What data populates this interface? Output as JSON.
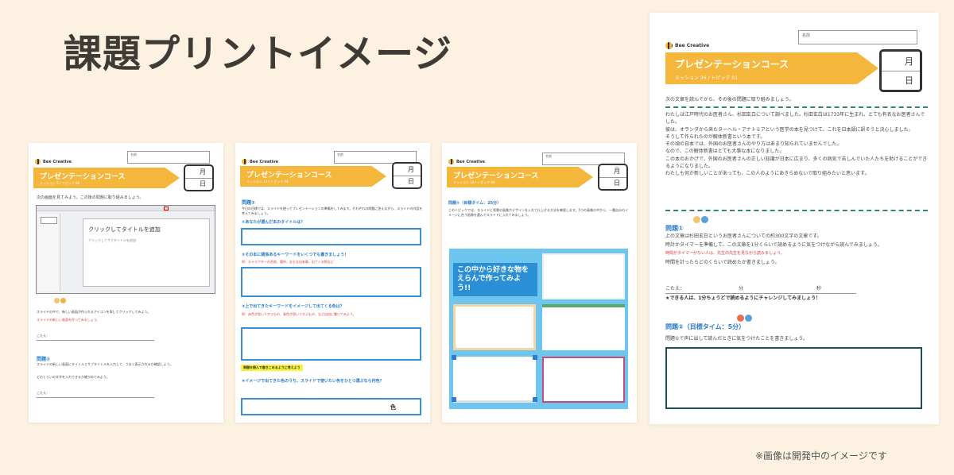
{
  "title": "課題プリントイメージ",
  "footnote": "※画像は開発中のイメージです",
  "common": {
    "brand": "Bee Creative",
    "name_label": "名前",
    "course": "プレゼンテーションコース",
    "month": "月",
    "day": "日"
  },
  "page1": {
    "sub": "ミッション 5 / トピック 04",
    "intro": "次の画面を見てみよう。この後の問題に取り組みましょう。",
    "slide_title": "クリックしてタイトルを追加",
    "slide_sub": "クリックしてサブタイトルを追加",
    "q1_text": "スライドの中で、新しい画面が作られるアイコンを探してクリックしてみよう。",
    "q1_red": "スライドの新しい画面を作ってみましょう。",
    "answer_label": "こたえ：",
    "q2_label": "問題②",
    "q2_text": "スライドの新しい画面にタイトルとサブタイトルを入力して、うまく表示されるか確認しよう。",
    "q2_text2": "どのくらいの文字を入力できるか確かめてみよう。"
  },
  "page2": {
    "sub": "ミッション 13 / トピック 04",
    "q1_label": "問題①",
    "q1_text": "今日の目標では、スライドを使ってプレゼンテーションの準備をしてみます。それぞれの問題に答えながら、スライドの内容を考えてみましょう。",
    "s1": "①あなたが選んだ本のタイトルは？",
    "s2": "②その本に関係あるキーワードをいくつでも書きましょう！",
    "s2_red": "例：キャラクターの名前、場所、おもな出来事、出てくる物など",
    "s3": "③上で出てきたキーワードをイメージして出てくる色は？",
    "s3_red": "例：赤色が思いうかぶもの、青色が思いうかぶもの、など自由に書いてみよう。",
    "hl": "問題を読んで書きこめるように考えよう",
    "s4": "④イメージで出てきた色のうち、スライドで使いたい色をひとつ選ぶなら何色？",
    "color_unit": "色"
  },
  "page3": {
    "sub": "ミッション 14 / トピック 04",
    "q1_label": "問題①（目標タイム：25分）",
    "q1_text": "このトピックでは、スライドに背景の画像やデザインを入れて仕上げる方法を練習します。5つの画像の中から、一番自分のイメージに合う画像を選んでスライドに入れてみましょう。",
    "collage_text": "この中から好きな物をえらんで作ってみよう!!"
  },
  "page4": {
    "sub": "ミッション 26 / トピック 01",
    "intro": "次の文章を読んでから、その後の問題に取り組みましょう。",
    "para": [
      "わたしは江戸時代のお医者さん、杉田玄白について調べました。杉田玄白は1733年に生まれ、とても有名なお医者さんでした。",
      "彼は、オランダから来たターヘル・アナトミアという医学の本を見つけて、これを日本語に訳そうと決心しました。",
      "そうして作られたのが解体新書という本です。",
      "その頃の日本では、外国のお医者さんのやり方はあまり知られていませんでした。",
      "なので、この解体新書はとても大事な本になりました。",
      "この本のおかげで、外国のお医者さんの正しい知識が日本に広まり、多くの病気で苦しんでいた人たちを助けることができるようになりました。",
      "わたしも何か新しいことがあっても、この人のようにあきらめないで取り組みたいと思います。"
    ],
    "q1_label": "問題①",
    "q1_text": "上の文章は杉田玄白というお医者さんについての約300文字の文章です。",
    "q1_text2": "時計かタイマーを準備して、この文章を1分くらいで読めるように気をつけながら読んでみましょう。",
    "q1_red": "時間がタイマーがない人は、先生の先生を見ながら読みましょう。",
    "q1_text3": "時間を計ったらどのくらいで読めたか書きましょう。",
    "ans_label": "こたえ：",
    "ans_min": "分",
    "ans_sec": "秒",
    "challenge": "★できる人は、1分ちょうどで読めるようにチャレンジしてみましょう！",
    "q2_label": "問題②（目標タイム：5分）",
    "q2_text": "問題①で声に出して読んだときに気をつけたことを書きましょう。"
  }
}
